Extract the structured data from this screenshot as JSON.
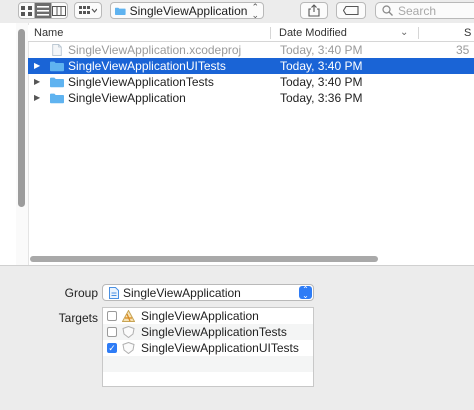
{
  "toolbar": {
    "path_label": "SingleViewApplication",
    "search_placeholder": "Search"
  },
  "browser": {
    "columns": {
      "name": "Name",
      "date": "Date Modified",
      "size": "S"
    },
    "rows": [
      {
        "name": "SingleViewApplication.xcodeproj",
        "date": "Today, 3:40 PM",
        "size": "35",
        "icon": "xcodeproj-file-icon",
        "expandable": false,
        "selected": false,
        "dimmed": true
      },
      {
        "name": "SingleViewApplicationUITests",
        "date": "Today, 3:40 PM",
        "size": "",
        "icon": "folder-icon",
        "expandable": true,
        "selected": true,
        "dimmed": false
      },
      {
        "name": "SingleViewApplicationTests",
        "date": "Today, 3:40 PM",
        "size": "",
        "icon": "folder-icon",
        "expandable": true,
        "selected": false,
        "dimmed": false
      },
      {
        "name": "SingleViewApplication",
        "date": "Today, 3:36 PM",
        "size": "",
        "icon": "folder-icon",
        "expandable": true,
        "selected": false,
        "dimmed": false
      }
    ]
  },
  "options": {
    "group_label": "Group",
    "group_value": "SingleViewApplication",
    "targets_label": "Targets",
    "targets": [
      {
        "name": "SingleViewApplication",
        "checked": false,
        "icon": "app-target-icon"
      },
      {
        "name": "SingleViewApplicationTests",
        "checked": false,
        "icon": "test-target-icon"
      },
      {
        "name": "SingleViewApplicationUITests",
        "checked": true,
        "icon": "test-target-icon"
      }
    ]
  },
  "colors": {
    "selection": "#1a64d6",
    "accent": "#2e7cf6",
    "folder": "#5fb3f0"
  }
}
